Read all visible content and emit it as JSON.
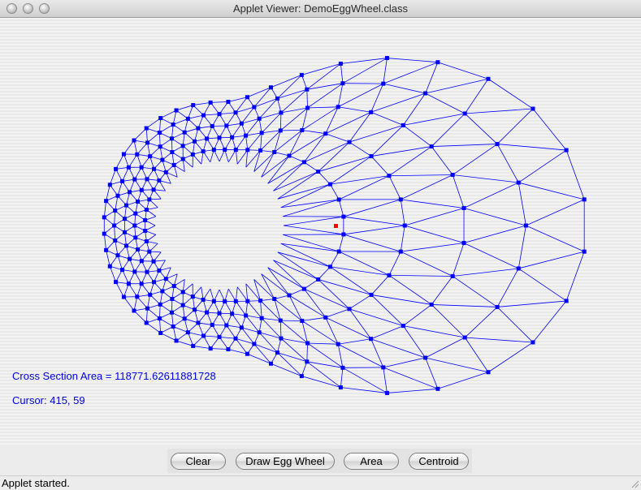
{
  "window": {
    "title": "Applet Viewer: DemoEggWheel.class"
  },
  "info": {
    "area_text": "Cross Section Area = 118771.62611881728",
    "cursor_text": "Cursor: 415, 59"
  },
  "buttons": {
    "clear": "Clear",
    "draw": "Draw Egg Wheel",
    "area": "Area",
    "centroid": "Centroid"
  },
  "status": {
    "text": "Applet started."
  },
  "colors": {
    "mesh": "#0000ff",
    "vertex": "#0000ff",
    "centroid": "#ff0000",
    "info_text": "#0000e0"
  },
  "icons": {
    "window_controls": [
      "close-light-icon",
      "minimize-light-icon",
      "zoom-light-icon"
    ],
    "resize": "resize-grip-icon"
  }
}
